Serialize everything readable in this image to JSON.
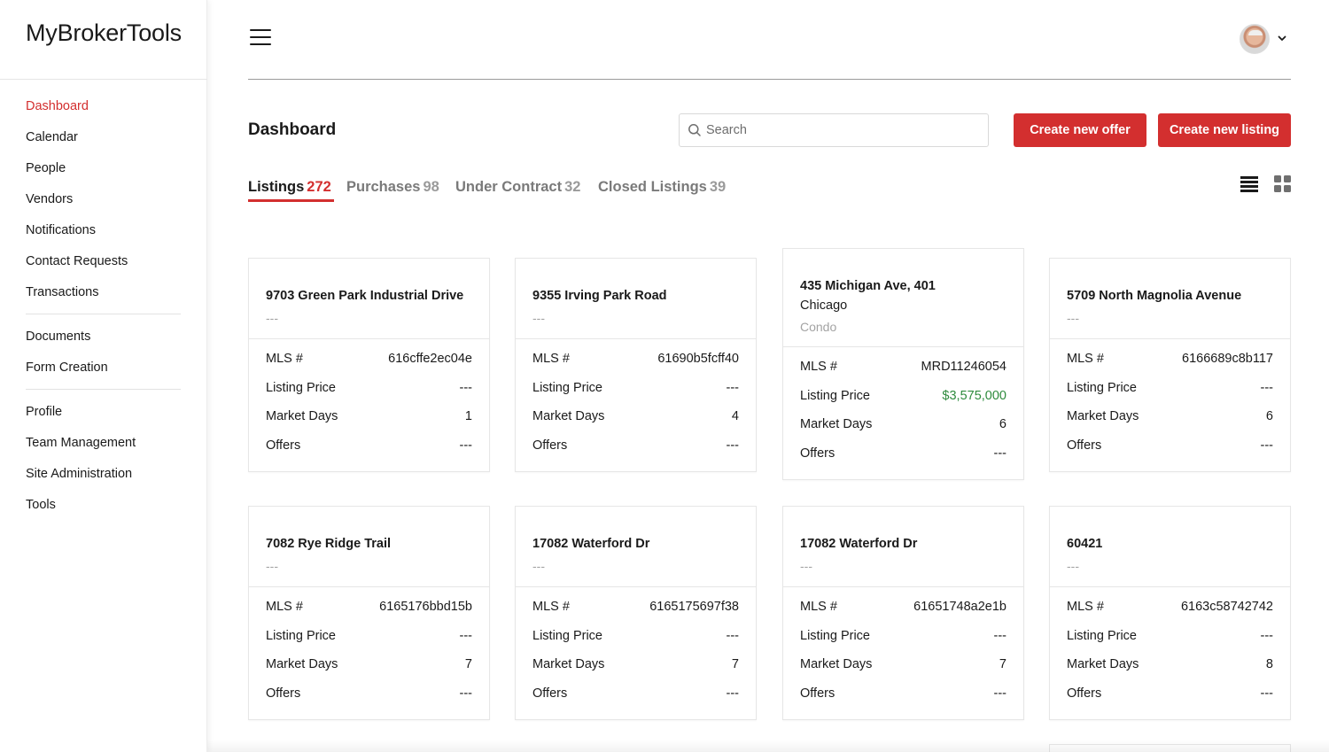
{
  "app": {
    "logo": "MyBrokerTools"
  },
  "sidebar": {
    "group1": [
      "Dashboard",
      "Calendar",
      "People",
      "Vendors",
      "Notifications",
      "Contact Requests",
      "Transactions"
    ],
    "group2": [
      "Documents",
      "Form Creation"
    ],
    "group3": [
      "Profile",
      "Team Management",
      "Site Administration",
      "Tools"
    ],
    "active": "Dashboard"
  },
  "header": {
    "menu_icon": "hamburger-icon",
    "avatar_icon": "user-avatar",
    "dropdown_icon": "chevron-down-icon"
  },
  "page": {
    "title": "Dashboard",
    "search_placeholder": "Search",
    "create_offer_label": "Create new offer",
    "create_listing_label": "Create new listing"
  },
  "tabs": [
    {
      "label": "Listings",
      "count": "272"
    },
    {
      "label": "Purchases",
      "count": "98"
    },
    {
      "label": "Under Contract",
      "count": "32"
    },
    {
      "label": "Closed Listings",
      "count": "39"
    }
  ],
  "view_toggle": {
    "list_icon": "list-view-icon",
    "grid_icon": "grid-view-icon"
  },
  "colors": {
    "accent": "#d32f2f",
    "price_green": "#2e8b3d"
  },
  "row_labels": {
    "mls": "MLS #",
    "price": "Listing Price",
    "days": "Market Days",
    "offers": "Offers"
  },
  "cards": [
    {
      "title": "9703 Green Park Industrial Drive",
      "city": "",
      "type": "---",
      "mls": "616cffe2ec04e",
      "price": "---",
      "days": "1",
      "offers": "---"
    },
    {
      "title": "9355 Irving Park Road",
      "city": "",
      "type": "---",
      "mls": "61690b5fcff40",
      "price": "---",
      "days": "4",
      "offers": "---"
    },
    {
      "title": "435 Michigan Ave, 401",
      "city": "Chicago",
      "type": "Condo",
      "mls": "MRD11246054",
      "price": "$3,575,000",
      "days": "6",
      "offers": "---"
    },
    {
      "title": "5709 North Magnolia Avenue",
      "city": "",
      "type": "---",
      "mls": "6166689c8b117",
      "price": "---",
      "days": "6",
      "offers": "---"
    },
    {
      "title": "7082 Rye Ridge Trail",
      "city": "",
      "type": "---",
      "mls": "6165176bbd15b",
      "price": "---",
      "days": "7",
      "offers": "---"
    },
    {
      "title": "17082 Waterford Dr",
      "city": "",
      "type": "---",
      "mls": "6165175697f38",
      "price": "---",
      "days": "7",
      "offers": "---"
    },
    {
      "title": "17082 Waterford Dr",
      "city": "",
      "type": "---",
      "mls": "61651748a2e1b",
      "price": "---",
      "days": "7",
      "offers": "---"
    },
    {
      "title": "60421",
      "city": "",
      "type": "---",
      "mls": "6163c58742742",
      "price": "---",
      "days": "8",
      "offers": "---"
    }
  ]
}
